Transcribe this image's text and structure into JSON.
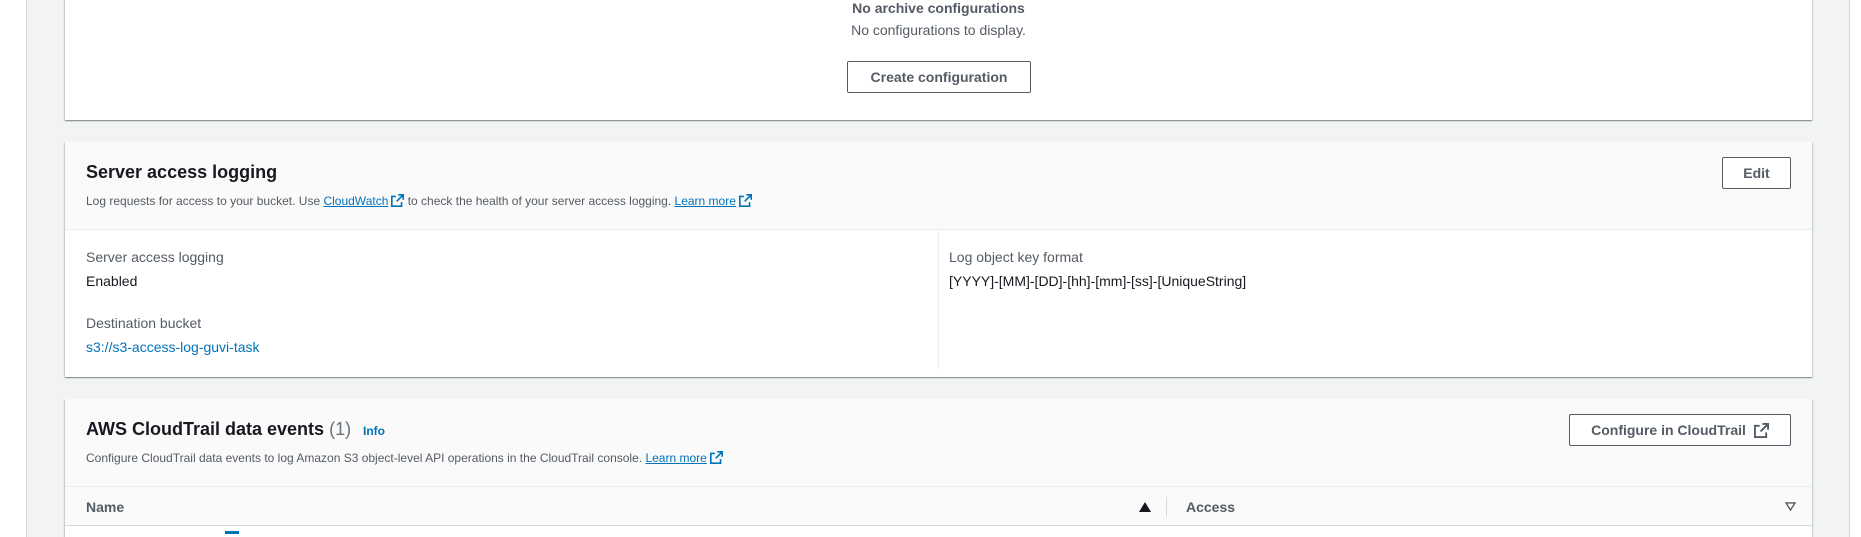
{
  "archive": {
    "empty_title": "No archive configurations",
    "empty_desc": "No configurations to display.",
    "create_button": "Create configuration"
  },
  "server_logging": {
    "title": "Server access logging",
    "desc_part1": "Log requests for access to your bucket. Use ",
    "cloudwatch_link": "CloudWatch",
    "desc_part2": " to check the health of your server access logging. ",
    "learn_more": "Learn more",
    "edit_button": "Edit",
    "status_label": "Server access logging",
    "status_value": "Enabled",
    "dest_label": "Destination bucket",
    "dest_value": "s3://s3-access-log-guvi-task",
    "key_format_label": "Log object key format",
    "key_format_value": "[YYYY]-[MM]-[DD]-[hh]-[mm]-[ss]-[UniqueString]"
  },
  "cloudtrail": {
    "title": "AWS CloudTrail data events",
    "count": "(1)",
    "info": "Info",
    "desc": "Configure CloudTrail data events to log Amazon S3 object-level API operations in the CloudTrail console. ",
    "learn_more": "Learn more",
    "configure_button": "Configure in CloudTrail",
    "columns": [
      "Name",
      "Access"
    ]
  },
  "colors": {
    "link": "#0073bb",
    "text": "#16191f",
    "muted": "#545b64"
  }
}
